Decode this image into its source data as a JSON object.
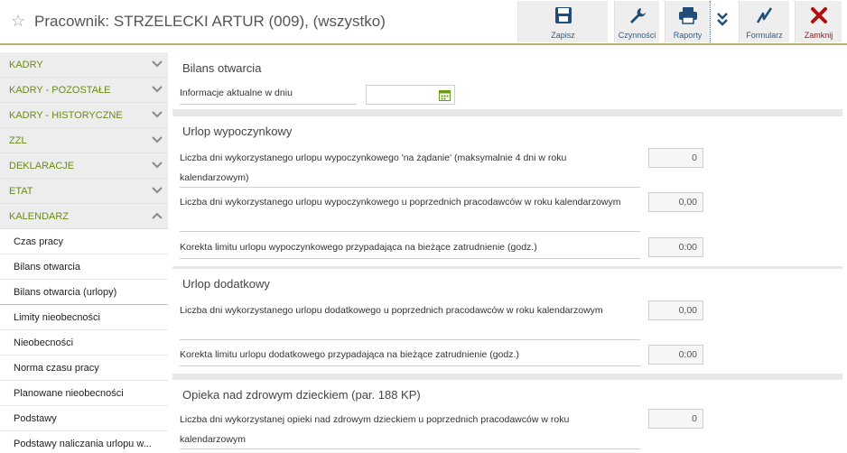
{
  "header": {
    "title": "Pracownik: STRZELECKI ARTUR (009), (wszystko)",
    "toolbar": {
      "save_label": "Zapisz",
      "actions_label": "Czynności",
      "reports_label": "Raporty",
      "form_label": "Formularz",
      "close_label": "Zamknij"
    }
  },
  "sidebar": {
    "sections": [
      {
        "label": "KADRY",
        "icon": "chevron-down-icon"
      },
      {
        "label": "KADRY - POZOSTAŁE",
        "icon": "chevron-down-icon"
      },
      {
        "label": "KADRY - HISTORYCZNE",
        "icon": "chevron-down-icon"
      },
      {
        "label": "ZZL",
        "icon": "chevron-down-icon"
      },
      {
        "label": "DEKLARACJE",
        "icon": "chevron-down-icon"
      },
      {
        "label": "ETAT",
        "icon": "chevron-down-icon"
      },
      {
        "label": "KALENDARZ",
        "icon": "chevron-up-icon"
      }
    ],
    "items": [
      {
        "label": "Czas pracy"
      },
      {
        "label": "Bilans otwarcia"
      },
      {
        "label": "Bilans otwarcia (urlopy)",
        "active": true
      },
      {
        "label": "Limity nieobecności"
      },
      {
        "label": "Nieobecności"
      },
      {
        "label": "Norma czasu pracy"
      },
      {
        "label": "Planowane nieobecności"
      },
      {
        "label": "Podstawy"
      },
      {
        "label": "Podstawy naliczania urlopu w..."
      }
    ]
  },
  "main": {
    "bilans": {
      "title": "Bilans otwarcia",
      "date_label": "Informacje aktualne w dniu",
      "date_value": ""
    },
    "urlop_wypoczynkowy": {
      "title": "Urlop wypoczynkowy",
      "rows": [
        {
          "label_line1": "Liczba dni wykorzystanego urlopu wypoczynkowego 'na żądanie' (maksymalnie 4 dni w roku",
          "label_line2": "kalendarzowym)",
          "value": "0"
        },
        {
          "label_line1": "Liczba dni wykorzystanego urlopu wypoczynkowego u poprzednich pracodawców w roku kalendarzowym",
          "value": "0,00"
        },
        {
          "label_line1": "Korekta limitu urlopu wypoczynkowego przypadająca na bieżące zatrudnienie (godz.)",
          "value": "0:00"
        }
      ]
    },
    "urlop_dodatkowy": {
      "title": "Urlop dodatkowy",
      "rows": [
        {
          "label_line1": "Liczba dni wykorzystanego urlopu dodatkowego u poprzednich pracodawców w roku kalendarzowym",
          "value": "0,00"
        },
        {
          "label_line1": "Korekta limitu urlopu dodatkowego przypadająca na bieżące zatrudnienie (godz.)",
          "value": "0:00"
        }
      ]
    },
    "opieka": {
      "title": "Opieka nad zdrowym dzieckiem (par. 188 KP)",
      "rows": [
        {
          "label_line1": "Liczba dni wykorzystanej opieki nad zdrowym dzieckiem u poprzednich pracodawców w roku",
          "label_line2": "kalendarzowym",
          "value": "0"
        }
      ]
    }
  },
  "colors": {
    "accent_line": "#b9b46a",
    "section_label": "#6a8a14",
    "toolbar_label": "#2e5d8a",
    "close_red": "#b01010"
  }
}
